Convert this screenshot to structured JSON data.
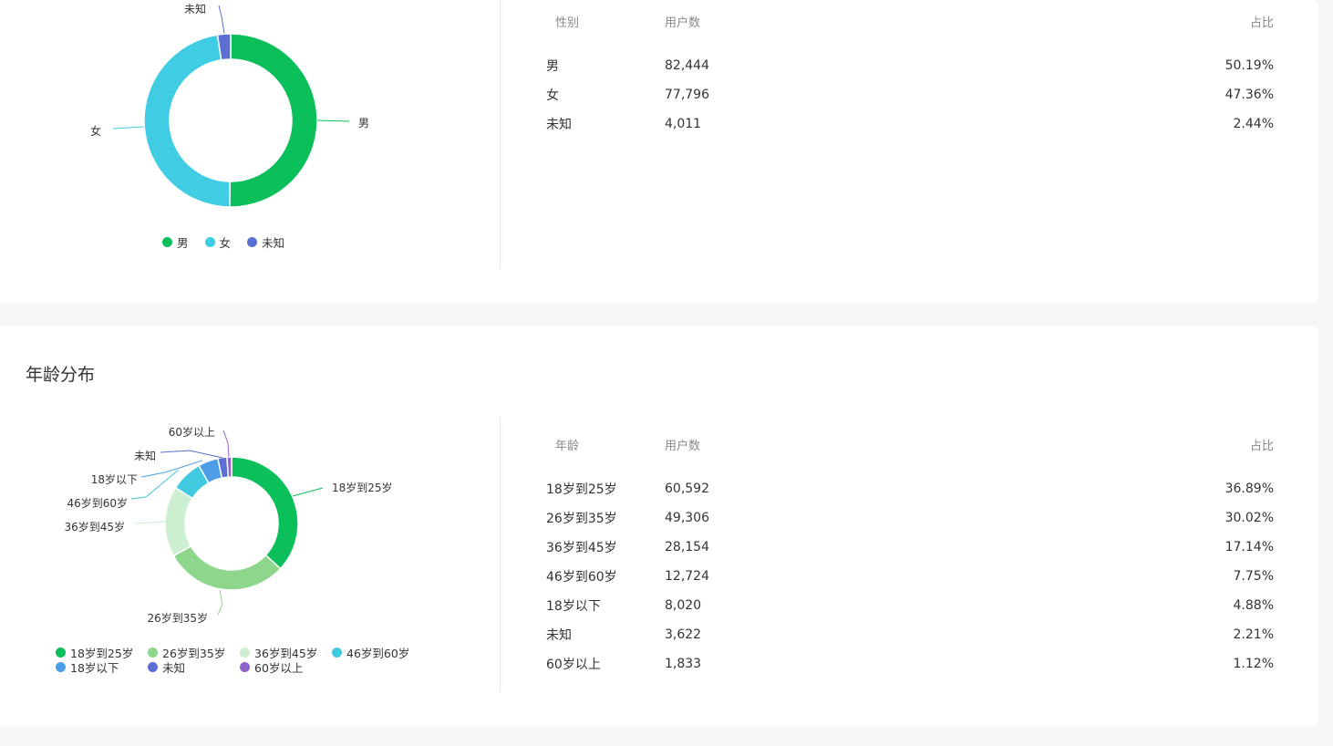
{
  "gender": {
    "table": {
      "headers": [
        "性别",
        "用户数",
        "占比"
      ],
      "rows": [
        {
          "label": "男",
          "count": "82,444",
          "pct": "50.19%"
        },
        {
          "label": "女",
          "count": "77,796",
          "pct": "47.36%"
        },
        {
          "label": "未知",
          "count": "4,011",
          "pct": "2.44%"
        }
      ]
    },
    "legend": [
      "男",
      "女",
      "未知"
    ]
  },
  "age": {
    "title": "年龄分布",
    "table": {
      "headers": [
        "年龄",
        "用户数",
        "占比"
      ],
      "rows": [
        {
          "label": "18岁到25岁",
          "count": "60,592",
          "pct": "36.89%"
        },
        {
          "label": "26岁到35岁",
          "count": "49,306",
          "pct": "30.02%"
        },
        {
          "label": "36岁到45岁",
          "count": "28,154",
          "pct": "17.14%"
        },
        {
          "label": "46岁到60岁",
          "count": "12,724",
          "pct": "7.75%"
        },
        {
          "label": "18岁以下",
          "count": "8,020",
          "pct": "4.88%"
        },
        {
          "label": "未知",
          "count": "3,622",
          "pct": "2.21%"
        },
        {
          "label": "60岁以上",
          "count": "1,833",
          "pct": "1.12%"
        }
      ]
    },
    "legend": [
      "18岁到25岁",
      "26岁到35岁",
      "36岁到45岁",
      "46岁到60岁",
      "18岁以下",
      "未知",
      "60岁以上"
    ]
  },
  "colors": {
    "male": "#0bbf5b",
    "female": "#40cde3",
    "unknown": "#5b6fd2",
    "age18_25": "#0bbf5b",
    "age26_35": "#8dd68b",
    "age36_45": "#cdefd1",
    "age46_60": "#40c9df",
    "under18": "#4d9ee6",
    "ageUnknown": "#5b6fd2",
    "over60": "#8d63c9"
  },
  "chart_data": [
    {
      "type": "pie",
      "variant": "donut",
      "categories": [
        "男",
        "女",
        "未知"
      ],
      "values": [
        82444,
        77796,
        4011
      ],
      "legend_position": "bottom"
    },
    {
      "type": "pie",
      "variant": "donut",
      "categories": [
        "18岁到25岁",
        "26岁到35岁",
        "36岁到45岁",
        "46岁到60岁",
        "18岁以下",
        "未知",
        "60岁以上"
      ],
      "values": [
        60592,
        49306,
        28154,
        12724,
        8020,
        3622,
        1833
      ],
      "legend_position": "bottom"
    }
  ]
}
